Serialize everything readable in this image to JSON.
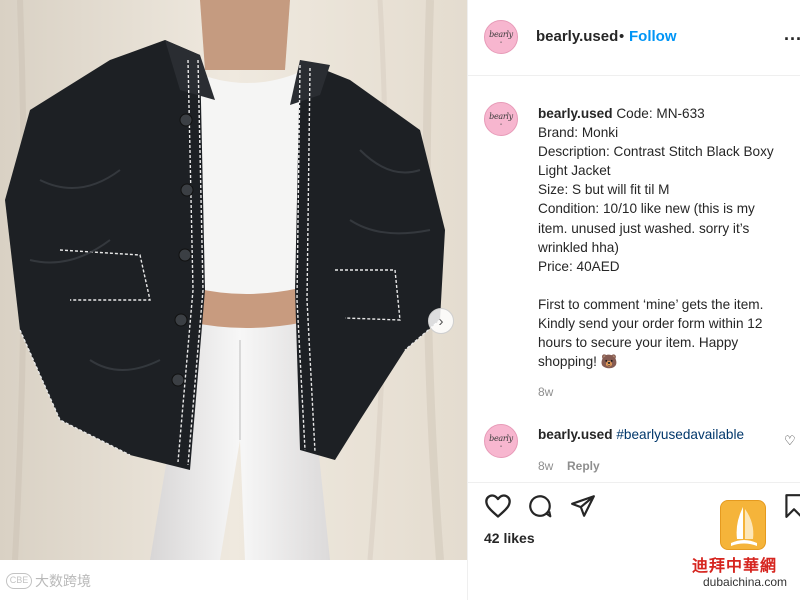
{
  "header": {
    "username": "bearly.used",
    "separator": "•",
    "follow_label": "Follow",
    "more_label": "...",
    "avatar_text": "bearly"
  },
  "caption": {
    "username": "bearly.used",
    "first_line": "Code: MN-633",
    "lines": [
      "Brand: Monki",
      "Description: Contrast Stitch Black Boxy",
      "Light Jacket",
      "Size: S but will fit til M",
      "Condition: 10/10 like new (this is my",
      "item. unused just washed. sorry it’s",
      "wrinkled hha)",
      "Price: 40AED"
    ],
    "lines2": [
      "First to comment ‘mine’ gets the item.",
      "Kindly send your order form within 12",
      "hours to secure your item. Happy",
      "shopping! 🐻"
    ],
    "time": "8w"
  },
  "comment": {
    "username": "bearly.used",
    "hashtag": "#bearlyusedavailable",
    "time": "8w",
    "reply_label": "Reply"
  },
  "likes": "42 likes",
  "watermarks": {
    "left_text": "大数跨境",
    "left_logo": "CBE",
    "right_cn": "迪拜中華網",
    "right_url": "dubaichina.com"
  },
  "icons": {
    "next": "chevron-right-icon",
    "like": "heart-icon",
    "comment": "comment-icon",
    "share": "paper-plane-icon",
    "save": "bookmark-icon"
  }
}
